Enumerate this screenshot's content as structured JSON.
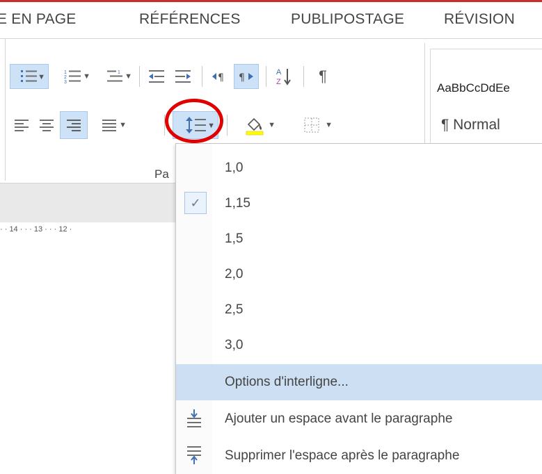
{
  "tabs": [
    "E EN PAGE",
    "RÉFÉRENCES",
    "PUBLIPOSTAGE",
    "RÉVISION"
  ],
  "ribbon": {
    "group_label": "Pa",
    "styles": {
      "sample": "AaBbCcDdEe",
      "normal": "¶ Normal"
    },
    "icons": {
      "row1": [
        "bullets-icon",
        "numbering-icon",
        "multilevel-list-icon",
        "decrease-indent-icon",
        "increase-indent-icon",
        "ltr-icon",
        "rtl-icon",
        "sort-icon",
        "show-marks-icon"
      ],
      "row2": [
        "align-left-icon",
        "align-center-icon",
        "align-right-icon",
        "justify-icon",
        "line-spacing-icon",
        "shading-icon",
        "borders-icon"
      ]
    },
    "accent": "#c72e2e",
    "selected_bg": "#cde1f7"
  },
  "ruler": {
    "text": "· · 14 · · · 13 · · · 12 ·"
  },
  "menu": {
    "values": [
      "1,0",
      "1,15",
      "1,5",
      "2,0",
      "2,5",
      "3,0"
    ],
    "checked": "1,15",
    "options": "Options d'interligne...",
    "add_before": "Ajouter un espace avant le paragraphe",
    "remove_after": "Supprimer l'espace après le paragraphe",
    "highlight_color": "#cddff3"
  },
  "annotation": {
    "color": "#e00000"
  }
}
